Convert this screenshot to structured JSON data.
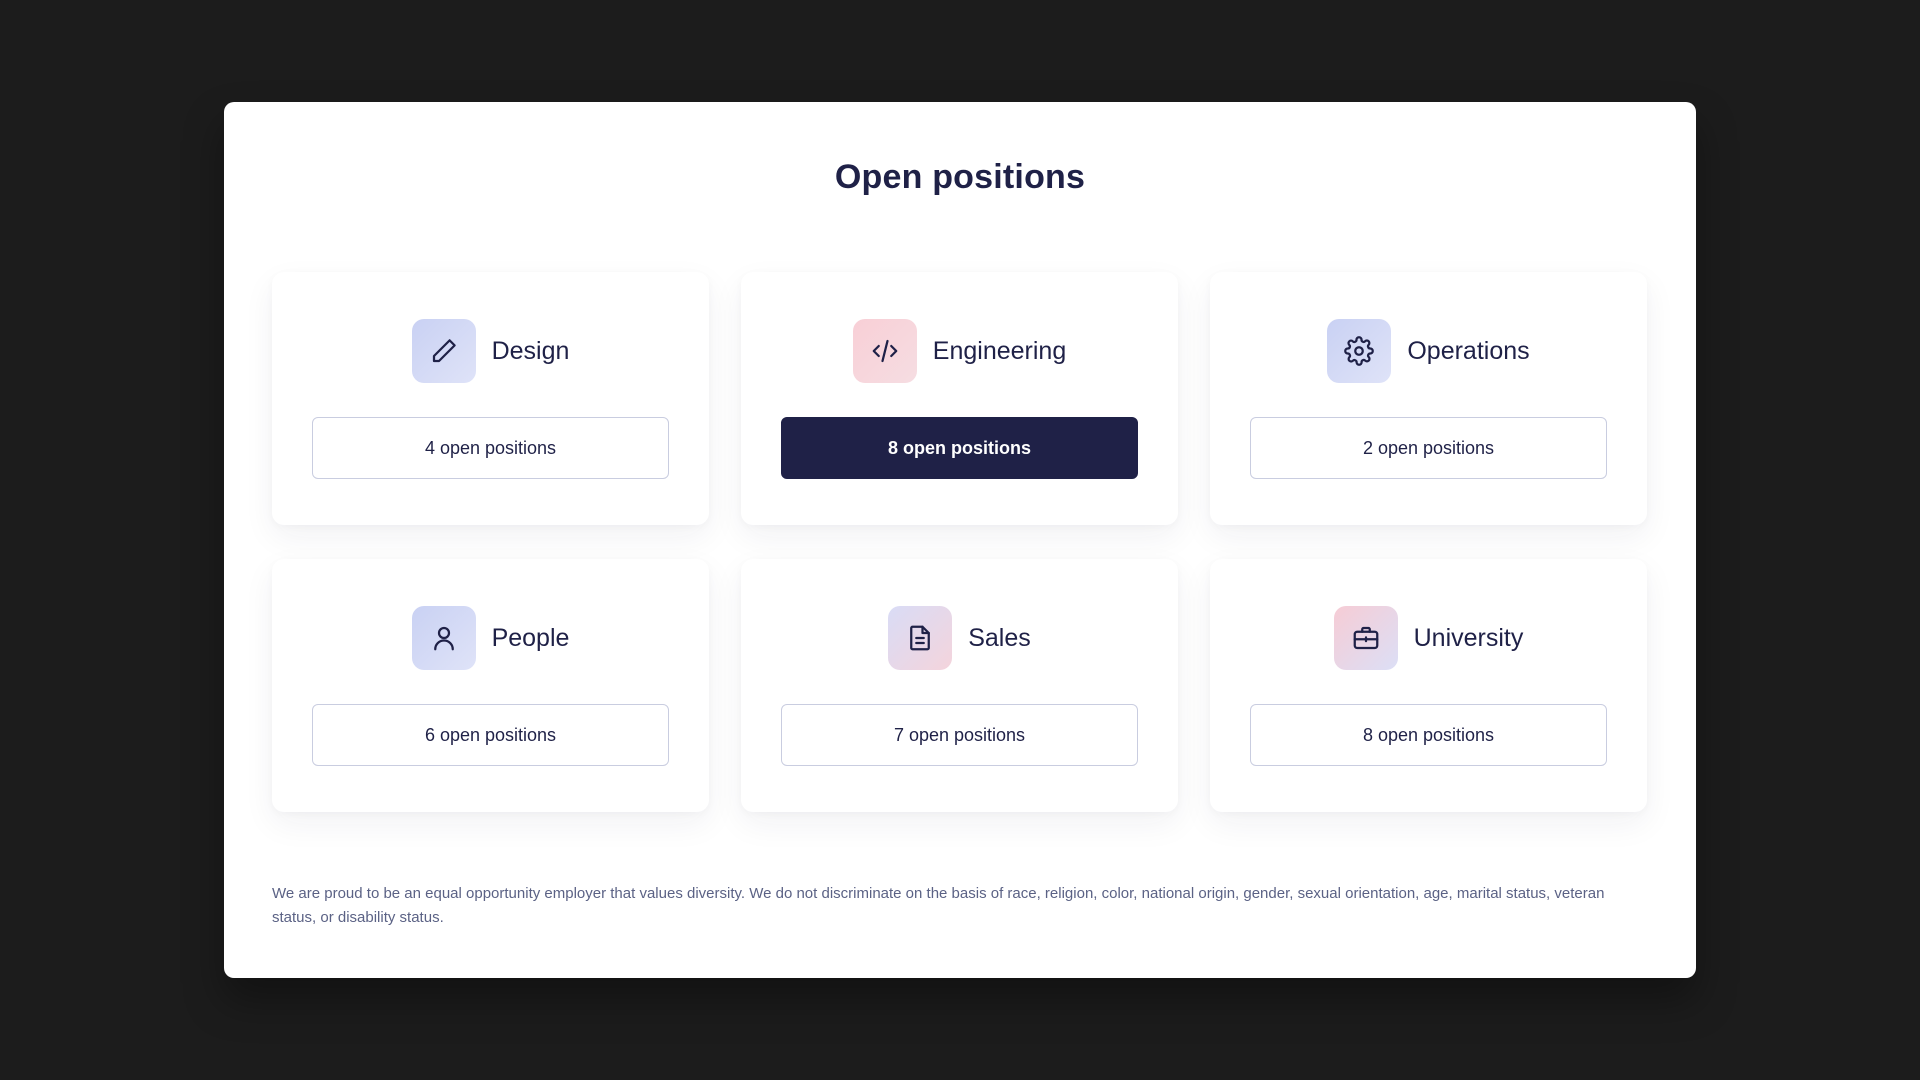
{
  "page": {
    "title": "Open positions",
    "disclaimer": "We are proud to be an equal opportunity employer that values diversity. We do not discriminate on the basis of race, religion, color, national origin, gender, sexual orientation, age, marital status, veteran status, or disability status."
  },
  "departments": [
    {
      "name": "Design",
      "icon": "pencil-icon",
      "positions_label": "4 open positions",
      "active": false
    },
    {
      "name": "Engineering",
      "icon": "code-icon",
      "positions_label": "8 open positions",
      "active": true
    },
    {
      "name": "Operations",
      "icon": "gear-icon",
      "positions_label": "2 open positions",
      "active": false
    },
    {
      "name": "People",
      "icon": "user-icon",
      "positions_label": "6 open positions",
      "active": false
    },
    {
      "name": "Sales",
      "icon": "document-icon",
      "positions_label": "7 open positions",
      "active": false
    },
    {
      "name": "University",
      "icon": "briefcase-icon",
      "positions_label": "8 open positions",
      "active": false
    }
  ],
  "colors": {
    "background": "#1c1c1c",
    "panel": "#ffffff",
    "navy": "#1f2147",
    "muted_text": "#5b6285",
    "border": "#c9cde0"
  }
}
